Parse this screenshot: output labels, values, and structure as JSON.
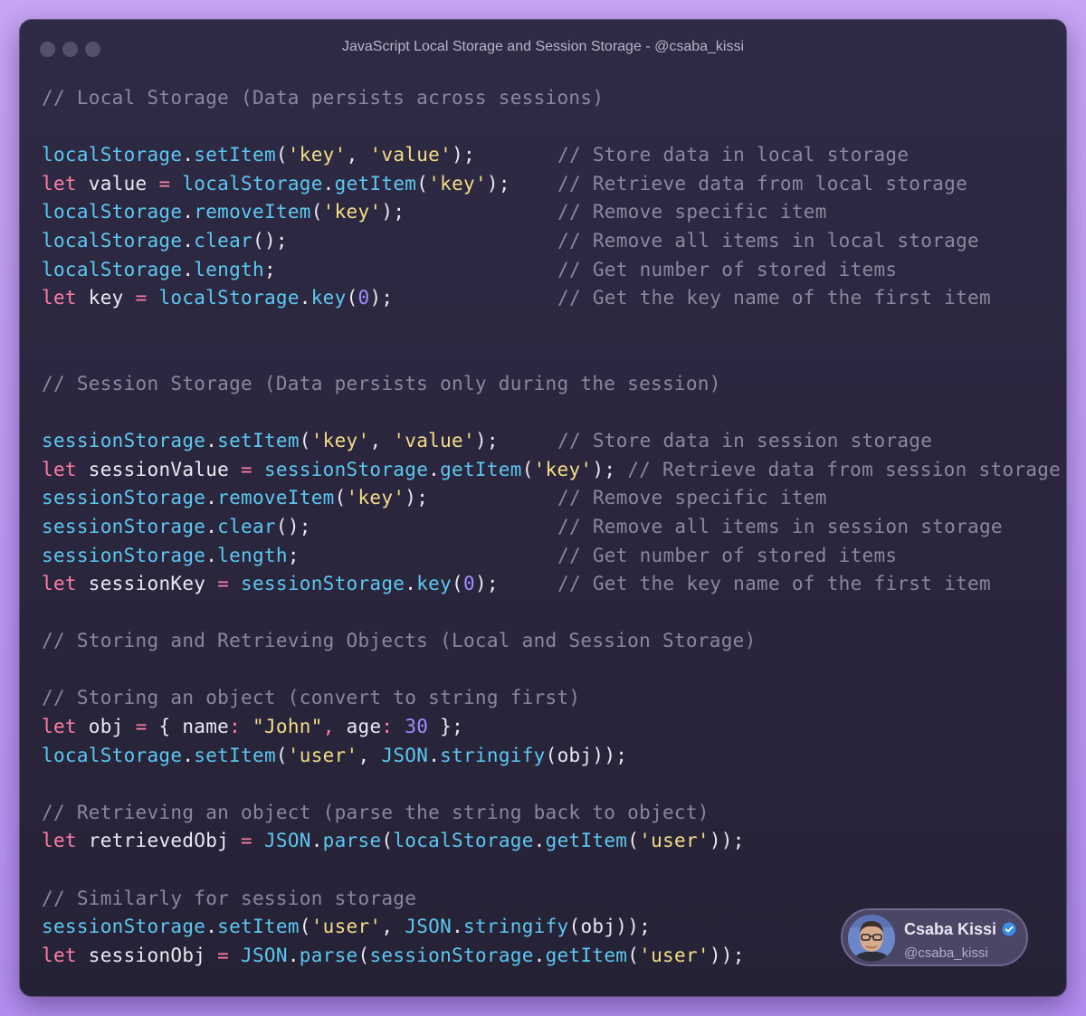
{
  "window": {
    "title": "JavaScript Local Storage and Session Storage - @csaba_kissi",
    "controls": [
      "close-dot",
      "minimize-dot",
      "maximize-dot"
    ]
  },
  "code_lines": [
    [
      [
        "cm",
        "// Local Storage (Data persists across sessions)"
      ]
    ],
    [],
    [
      [
        "obj",
        "localStorage"
      ],
      [
        "pl",
        "."
      ],
      [
        "obj",
        "setItem"
      ],
      [
        "pl",
        "("
      ],
      [
        "str",
        "'key'"
      ],
      [
        "pl",
        ", "
      ],
      [
        "str",
        "'value'"
      ],
      [
        "pl",
        ");"
      ],
      [
        "cmt",
        "// Store data in local storage"
      ]
    ],
    [
      [
        "kw",
        "let "
      ],
      [
        "pl",
        "value "
      ],
      [
        "kw",
        "= "
      ],
      [
        "obj",
        "localStorage"
      ],
      [
        "pl",
        "."
      ],
      [
        "obj",
        "getItem"
      ],
      [
        "pl",
        "("
      ],
      [
        "str",
        "'key'"
      ],
      [
        "pl",
        ");"
      ],
      [
        "cmt",
        "// Retrieve data from local storage"
      ]
    ],
    [
      [
        "obj",
        "localStorage"
      ],
      [
        "pl",
        "."
      ],
      [
        "obj",
        "removeItem"
      ],
      [
        "pl",
        "("
      ],
      [
        "str",
        "'key'"
      ],
      [
        "pl",
        ");"
      ],
      [
        "cmt",
        "// Remove specific item"
      ]
    ],
    [
      [
        "obj",
        "localStorage"
      ],
      [
        "pl",
        "."
      ],
      [
        "obj",
        "clear"
      ],
      [
        "pl",
        "();"
      ],
      [
        "cmt",
        "// Remove all items in local storage"
      ]
    ],
    [
      [
        "obj",
        "localStorage"
      ],
      [
        "pl",
        "."
      ],
      [
        "obj",
        "length"
      ],
      [
        "pl",
        ";"
      ],
      [
        "cmt",
        "// Get number of stored items"
      ]
    ],
    [
      [
        "kw",
        "let "
      ],
      [
        "pl",
        "key "
      ],
      [
        "kw",
        "= "
      ],
      [
        "obj",
        "localStorage"
      ],
      [
        "pl",
        "."
      ],
      [
        "obj",
        "key"
      ],
      [
        "pl",
        "("
      ],
      [
        "num",
        "0"
      ],
      [
        "pl",
        ");"
      ],
      [
        "cmt",
        "// Get the key name of the first item"
      ]
    ],
    [],
    [],
    [
      [
        "cm",
        "// Session Storage (Data persists only during the session)"
      ]
    ],
    [],
    [
      [
        "obj",
        "sessionStorage"
      ],
      [
        "pl",
        "."
      ],
      [
        "obj",
        "setItem"
      ],
      [
        "pl",
        "("
      ],
      [
        "str",
        "'key'"
      ],
      [
        "pl",
        ", "
      ],
      [
        "str",
        "'value'"
      ],
      [
        "pl",
        ");"
      ],
      [
        "cmt",
        "// Store data in session storage"
      ]
    ],
    [
      [
        "kw",
        "let "
      ],
      [
        "pl",
        "sessionValue "
      ],
      [
        "kw",
        "= "
      ],
      [
        "obj",
        "sessionStorage"
      ],
      [
        "pl",
        "."
      ],
      [
        "obj",
        "getItem"
      ],
      [
        "pl",
        "("
      ],
      [
        "str",
        "'key'"
      ],
      [
        "pl",
        "); "
      ],
      [
        "cm",
        "// Retrieve data from session storage"
      ]
    ],
    [
      [
        "obj",
        "sessionStorage"
      ],
      [
        "pl",
        "."
      ],
      [
        "obj",
        "removeItem"
      ],
      [
        "pl",
        "("
      ],
      [
        "str",
        "'key'"
      ],
      [
        "pl",
        ");"
      ],
      [
        "cmt",
        "// Remove specific item"
      ]
    ],
    [
      [
        "obj",
        "sessionStorage"
      ],
      [
        "pl",
        "."
      ],
      [
        "obj",
        "clear"
      ],
      [
        "pl",
        "();"
      ],
      [
        "cmt",
        "// Remove all items in session storage"
      ]
    ],
    [
      [
        "obj",
        "sessionStorage"
      ],
      [
        "pl",
        "."
      ],
      [
        "obj",
        "length"
      ],
      [
        "pl",
        ";"
      ],
      [
        "cmt",
        "// Get number of stored items"
      ]
    ],
    [
      [
        "kw",
        "let "
      ],
      [
        "pl",
        "sessionKey "
      ],
      [
        "kw",
        "= "
      ],
      [
        "obj",
        "sessionStorage"
      ],
      [
        "pl",
        "."
      ],
      [
        "obj",
        "key"
      ],
      [
        "pl",
        "("
      ],
      [
        "num",
        "0"
      ],
      [
        "pl",
        ");"
      ],
      [
        "cmt",
        "// Get the key name of the first item"
      ]
    ],
    [],
    [
      [
        "cm",
        "// Storing and Retrieving Objects (Local and Session Storage)"
      ]
    ],
    [],
    [
      [
        "cm",
        "// Storing an object (convert to string first)"
      ]
    ],
    [
      [
        "kw",
        "let "
      ],
      [
        "pl",
        "obj "
      ],
      [
        "kw",
        "= "
      ],
      [
        "pl",
        "{ name"
      ],
      [
        "kw",
        ": "
      ],
      [
        "str",
        "\"John\""
      ],
      [
        "kw",
        ", "
      ],
      [
        "pl",
        "age"
      ],
      [
        "kw",
        ": "
      ],
      [
        "num",
        "30"
      ],
      [
        "pl",
        " };"
      ]
    ],
    [
      [
        "obj",
        "localStorage"
      ],
      [
        "pl",
        "."
      ],
      [
        "obj",
        "setItem"
      ],
      [
        "pl",
        "("
      ],
      [
        "str",
        "'user'"
      ],
      [
        "pl",
        ", "
      ],
      [
        "obj",
        "JSON"
      ],
      [
        "pl",
        "."
      ],
      [
        "obj",
        "stringify"
      ],
      [
        "pl",
        "(obj));"
      ]
    ],
    [],
    [
      [
        "cm",
        "// Retrieving an object (parse the string back to object)"
      ]
    ],
    [
      [
        "kw",
        "let "
      ],
      [
        "pl",
        "retrievedObj "
      ],
      [
        "kw",
        "= "
      ],
      [
        "obj",
        "JSON"
      ],
      [
        "pl",
        "."
      ],
      [
        "obj",
        "parse"
      ],
      [
        "pl",
        "("
      ],
      [
        "obj",
        "localStorage"
      ],
      [
        "pl",
        "."
      ],
      [
        "obj",
        "getItem"
      ],
      [
        "pl",
        "("
      ],
      [
        "str",
        "'user'"
      ],
      [
        "pl",
        "));"
      ]
    ],
    [],
    [
      [
        "cm",
        "// Similarly for session storage"
      ]
    ],
    [
      [
        "obj",
        "sessionStorage"
      ],
      [
        "pl",
        "."
      ],
      [
        "obj",
        "setItem"
      ],
      [
        "pl",
        "("
      ],
      [
        "str",
        "'user'"
      ],
      [
        "pl",
        ", "
      ],
      [
        "obj",
        "JSON"
      ],
      [
        "pl",
        "."
      ],
      [
        "obj",
        "stringify"
      ],
      [
        "pl",
        "(obj));"
      ]
    ],
    [
      [
        "kw",
        "let "
      ],
      [
        "pl",
        "sessionObj "
      ],
      [
        "kw",
        "= "
      ],
      [
        "obj",
        "JSON"
      ],
      [
        "pl",
        "."
      ],
      [
        "obj",
        "parse"
      ],
      [
        "pl",
        "("
      ],
      [
        "obj",
        "sessionStorage"
      ],
      [
        "pl",
        "."
      ],
      [
        "obj",
        "getItem"
      ],
      [
        "pl",
        "("
      ],
      [
        "str",
        "'user'"
      ],
      [
        "pl",
        "));"
      ]
    ]
  ],
  "badge": {
    "name": "Csaba Kissi",
    "handle": "@csaba_kissi",
    "verified_icon": "verified-check-icon",
    "avatar_icon": "profile-photo"
  },
  "colors": {
    "background": "#c7a6f4",
    "editor": "#2f2a45",
    "comment": "#8c879f",
    "identifier": "#5cc8f0",
    "string": "#f3dd86",
    "keyword": "#ff7ea6",
    "number": "#a38cff",
    "plain": "#ece9f2"
  }
}
